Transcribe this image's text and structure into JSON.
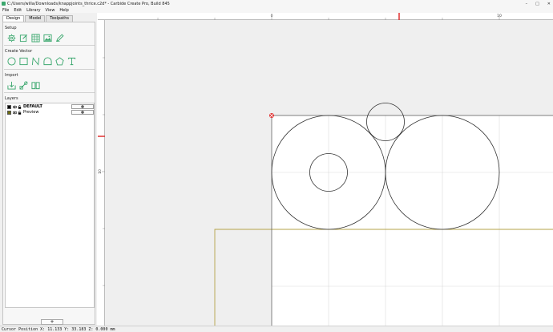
{
  "window": {
    "title": "C:/Users/willa/Downloads/knappjoints_thrice.c2d* - Carbide Create Pro, Build 845",
    "controls": [
      "–",
      "□",
      "✕"
    ]
  },
  "menu": [
    "File",
    "Edit",
    "Library",
    "View",
    "Help"
  ],
  "tabs": [
    {
      "label": "Design",
      "active": true
    },
    {
      "label": "Model",
      "active": false
    },
    {
      "label": "Toolpaths",
      "active": false
    }
  ],
  "sections": {
    "setup": "Setup",
    "create_vector": "Create Vector",
    "import": "Import",
    "layers": "Layers"
  },
  "setup_tools": [
    "settings-icon",
    "edit-page-icon",
    "grid-icon",
    "image-icon",
    "pen-icon"
  ],
  "vector_tools": [
    "circle-icon",
    "rectangle-icon",
    "curve-icon",
    "polygon-icon",
    "pentagon-icon",
    "text-icon"
  ],
  "import_tools": [
    "import-icon",
    "trace-icon",
    "book-icon"
  ],
  "layers": [
    {
      "name": "DEFAULT",
      "color": "#000000",
      "bold": true
    },
    {
      "name": "Preview",
      "color": "#6b6b10",
      "bold": false
    }
  ],
  "add_layer_label": "+",
  "ruler": {
    "h_labels": [
      "0",
      "10"
    ],
    "v_labels": [
      "10"
    ]
  },
  "status": {
    "text": "Cursor Position X: 11.133 Y: 33.183 Z: 0.000 mm"
  },
  "colors": {
    "accent_green": "#3aa76d",
    "material_outline": "#b5a34a",
    "origin_marker": "#e03030"
  }
}
